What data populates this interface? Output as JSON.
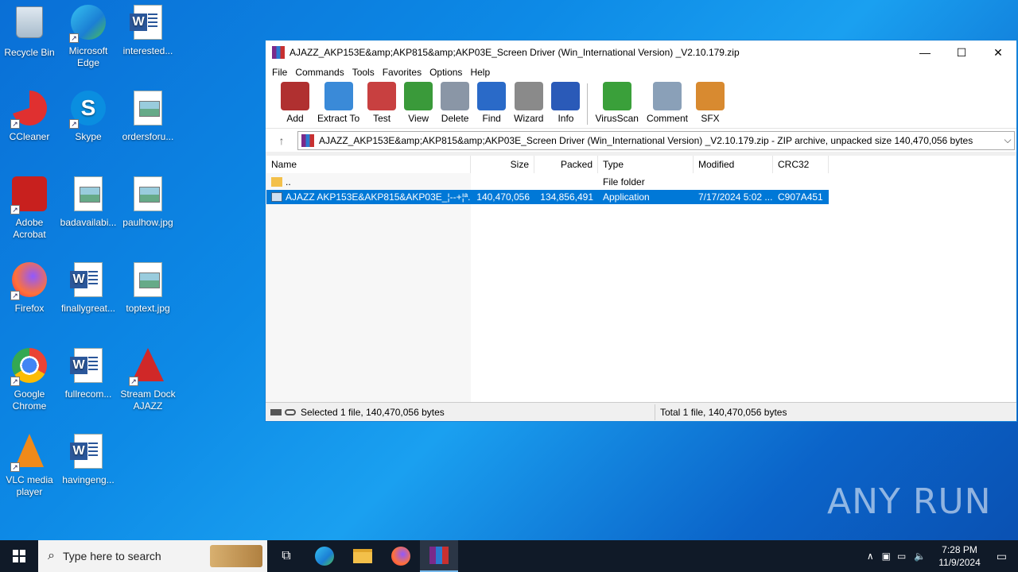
{
  "desktop": {
    "icons": [
      {
        "label": "Recycle Bin",
        "icon": "recycle-bin-icon"
      },
      {
        "label": "Microsoft Edge",
        "icon": "edge-icon"
      },
      {
        "label": "interested...",
        "icon": "word-doc-icon"
      },
      {
        "label": "CCleaner",
        "icon": "ccleaner-icon"
      },
      {
        "label": "Skype",
        "icon": "skype-icon"
      },
      {
        "label": "ordersforu...",
        "icon": "image-file-icon"
      },
      {
        "label": "Adobe Acrobat",
        "icon": "acrobat-icon"
      },
      {
        "label": "badavailabi...",
        "icon": "image-file-icon"
      },
      {
        "label": "paulhow.jpg",
        "icon": "image-file-icon"
      },
      {
        "label": "Firefox",
        "icon": "firefox-icon"
      },
      {
        "label": "finallygreat...",
        "icon": "word-doc-icon"
      },
      {
        "label": "toptext.jpg",
        "icon": "image-file-icon"
      },
      {
        "label": "Google Chrome",
        "icon": "chrome-icon"
      },
      {
        "label": "fullrecom...",
        "icon": "word-doc-icon"
      },
      {
        "label": "Stream Dock AJAZZ",
        "icon": "stream-dock-icon"
      },
      {
        "label": "VLC media player",
        "icon": "vlc-icon"
      },
      {
        "label": "havingeng...",
        "icon": "word-doc-icon"
      }
    ]
  },
  "window": {
    "title": "AJAZZ_AKP153E&amp;AKP815&amp;AKP03E_Screen Driver (Win_International Version) _V2.10.179.zip",
    "controls": {
      "minimize": "—",
      "maximize": "☐",
      "close": "✕"
    },
    "menu": [
      "File",
      "Commands",
      "Tools",
      "Favorites",
      "Options",
      "Help"
    ],
    "toolbar": [
      {
        "label": "Add",
        "icon": "add-archive-icon",
        "color": "#b03030"
      },
      {
        "label": "Extract To",
        "icon": "extract-folder-icon",
        "color": "#3a8ad8"
      },
      {
        "label": "Test",
        "icon": "test-clipboard-icon",
        "color": "#c84040"
      },
      {
        "label": "View",
        "icon": "view-book-icon",
        "color": "#3a9a3a"
      },
      {
        "label": "Delete",
        "icon": "delete-bin-icon",
        "color": "#8a96a6"
      },
      {
        "label": "Find",
        "icon": "find-magnifier-icon",
        "color": "#2a6ac8"
      },
      {
        "label": "Wizard",
        "icon": "wizard-wand-icon",
        "color": "#8a8a8a"
      },
      {
        "label": "Info",
        "icon": "info-icon",
        "color": "#2a5ab8"
      },
      {
        "label": "VirusScan",
        "icon": "virus-scan-icon",
        "color": "#3aa03a"
      },
      {
        "label": "Comment",
        "icon": "comment-icon",
        "color": "#8aa0b8"
      },
      {
        "label": "SFX",
        "icon": "sfx-icon",
        "color": "#d88a30"
      }
    ],
    "address": "AJAZZ_AKP153E&amp;AKP815&amp;AKP03E_Screen Driver (Win_International Version) _V2.10.179.zip - ZIP archive, unpacked size 140,470,056 bytes",
    "columns": [
      "Name",
      "Size",
      "Packed",
      "Type",
      "Modified",
      "CRC32"
    ],
    "rows": [
      {
        "name": "..",
        "size": "",
        "packed": "",
        "type": "File folder",
        "modified": "",
        "crc": "",
        "selected": false
      },
      {
        "name": "AJAZZ AKP153E&AKP815&AKP03E_¦--+¦ª...",
        "size": "140,470,056",
        "packed": "134,856,491",
        "type": "Application",
        "modified": "7/17/2024 5:02 ...",
        "crc": "C907A451",
        "selected": true
      }
    ],
    "status_left": "Selected 1 file, 140,470,056 bytes",
    "status_right": "Total 1 file, 140,470,056 bytes"
  },
  "taskbar": {
    "search_placeholder": "Type here to search",
    "time": "7:28 PM",
    "date": "11/9/2024"
  },
  "watermark": "ANY RUN"
}
